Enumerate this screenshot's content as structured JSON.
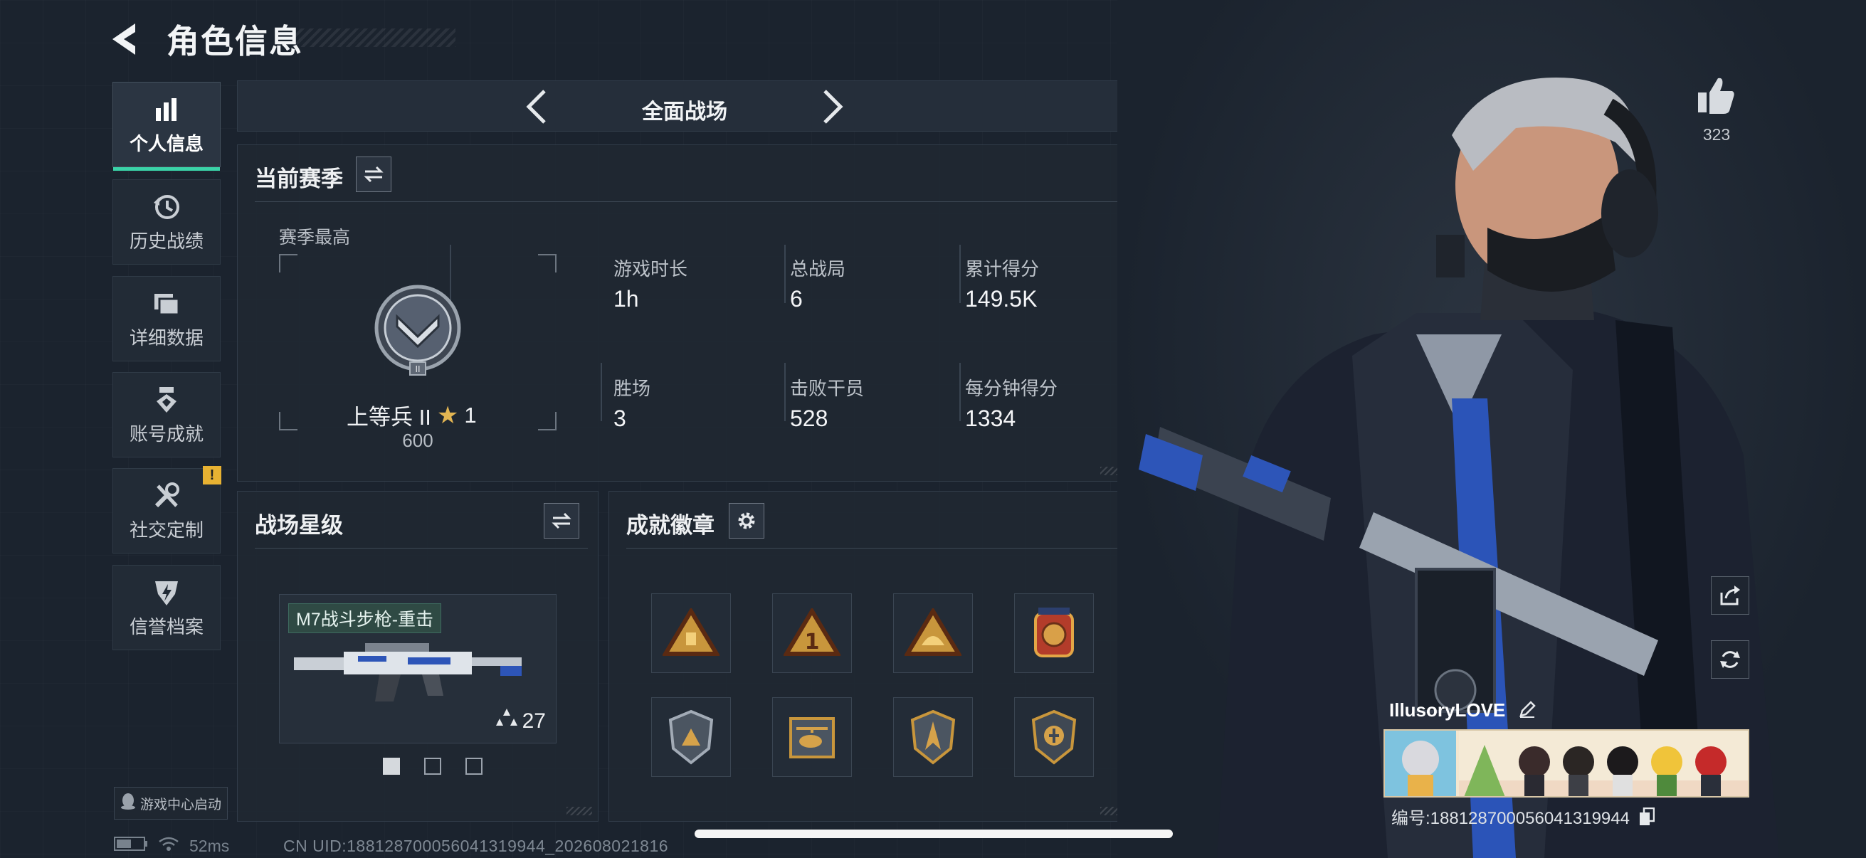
{
  "header": {
    "title": "角色信息"
  },
  "sidebar": {
    "items": [
      {
        "label": "个人信息",
        "icon": "bar-chart-icon",
        "active": true
      },
      {
        "label": "历史战绩",
        "icon": "history-clock-icon"
      },
      {
        "label": "详细数据",
        "icon": "folder-stack-icon"
      },
      {
        "label": "账号成就",
        "icon": "achievement-medal-icon"
      },
      {
        "label": "社交定制",
        "icon": "tools-icon",
        "badge": "!"
      },
      {
        "label": "信誉档案",
        "icon": "credibility-shield-icon"
      }
    ],
    "game_center": "游戏中心启动"
  },
  "mode": {
    "title": "全面战场"
  },
  "season": {
    "heading": "当前赛季",
    "best_label": "赛季最高",
    "rank_name": "上等兵 II",
    "rank_stars": "1",
    "rank_points": "600",
    "stats": [
      {
        "label": "游戏时长",
        "value": "1h"
      },
      {
        "label": "总战局",
        "value": "6"
      },
      {
        "label": "累计得分",
        "value": "149.5K"
      },
      {
        "label": "胜场",
        "value": "3"
      },
      {
        "label": "击败干员",
        "value": "528"
      },
      {
        "label": "每分钟得分",
        "value": "1334"
      }
    ]
  },
  "star_level": {
    "heading": "战场星级",
    "weapon_name": "M7战斗步枪-重击",
    "weapon_stars": "27",
    "page_total": 3,
    "page_active": 1
  },
  "achievements": {
    "heading": "成就徽章",
    "medals": [
      "triangle-gold-medal-icon",
      "triangle-one-medal-icon",
      "triangle-sun-medal-icon",
      "circle-crest-medal-icon",
      "shield-silver-medal-icon",
      "helicopter-medal-icon",
      "shield-arrow-medal-icon",
      "shield-emblem-medal-icon"
    ]
  },
  "profile": {
    "likes": "323",
    "player_name": "IllusoryLOVE",
    "player_id": "编号:18812870005604131994​4"
  },
  "status": {
    "ping": "52ms",
    "uid": "CN UID:18812870005604131994​4_202608021816"
  },
  "colors": {
    "accent": "#3ad3a8",
    "badge": "#e8b232",
    "gold": "#c8963c"
  }
}
